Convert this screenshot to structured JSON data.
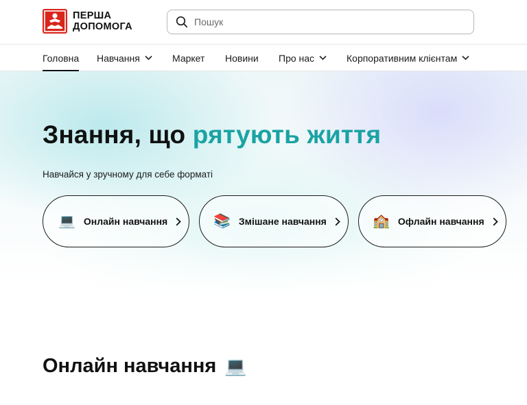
{
  "logo": {
    "line1": "ПЕРША",
    "line2": "ДОПОМОГА"
  },
  "search": {
    "placeholder": "Пошук",
    "value": ""
  },
  "nav": {
    "items": [
      {
        "label": "Головна",
        "active": true,
        "dropdown": false
      },
      {
        "label": "Навчання",
        "active": false,
        "dropdown": true
      },
      {
        "label": "Маркет",
        "active": false,
        "dropdown": false
      },
      {
        "label": "Новини",
        "active": false,
        "dropdown": false
      },
      {
        "label": "Про нас",
        "active": false,
        "dropdown": true
      },
      {
        "label": "Корпоративним клієнтам",
        "active": false,
        "dropdown": true
      }
    ]
  },
  "hero": {
    "title_part1": "Знання, що ",
    "title_accent": "рятують життя",
    "subtitle": "Навчайся у зручному для себе форматі",
    "options": [
      {
        "emoji": "💻",
        "label": "Онлайн навчання"
      },
      {
        "emoji": "📚",
        "label": "Змішане навчання"
      },
      {
        "emoji": "🏫",
        "label": "Офлайн навчання"
      }
    ]
  },
  "section": {
    "title": "Онлайн навчання",
    "emoji": "💻"
  },
  "colors": {
    "brand_red": "#d9261c",
    "accent_teal": "#1aa3a3",
    "text": "#111111"
  },
  "icons": {
    "search": "search-icon",
    "chevron_down": "chevron-down-icon",
    "chevron_right": "chevron-right-icon"
  }
}
